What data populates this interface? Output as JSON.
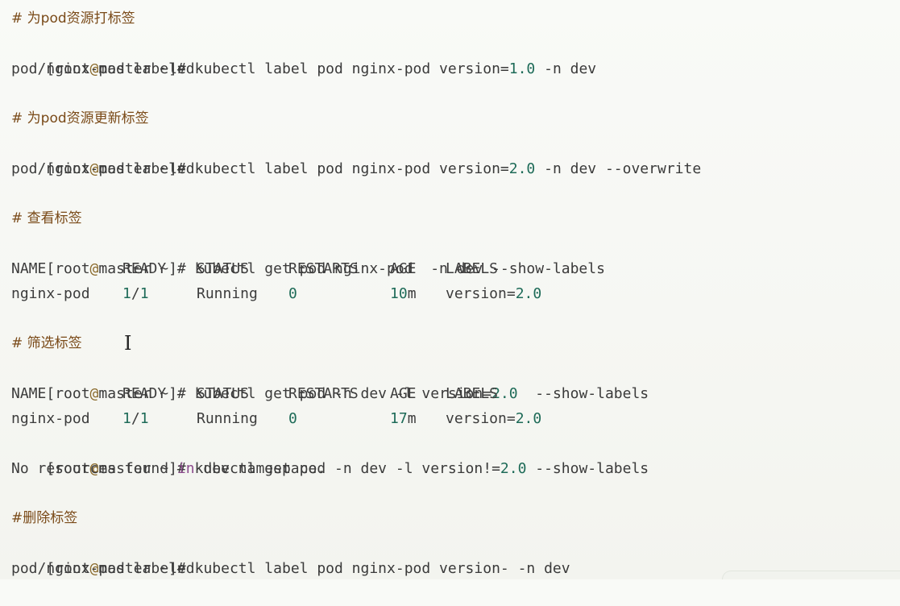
{
  "terminal": {
    "prompt": {
      "open": "[root",
      "at": "@",
      "host": "master",
      "rest": " ~]# "
    },
    "blocks": [
      {
        "comment": "# 为pod资源打标签",
        "command": "kubectl label pod nginx-pod version=1.0 -n dev",
        "output": "pod/nginx-pod labeled"
      },
      {
        "comment": "# 为pod资源更新标签",
        "command": "kubectl label pod nginx-pod version=2.0 -n dev --overwrite",
        "output": "pod/nginx-pod labeled"
      },
      {
        "comment": "# 查看标签",
        "command": "kubectl get pod nginx-pod  -n dev --show-labels",
        "table": {
          "headers": [
            "NAME",
            "READY",
            "STATUS",
            "RESTARTS",
            "AGE",
            "LABELS"
          ],
          "rows": [
            [
              "nginx-pod",
              "1/1",
              "Running",
              "0",
              "10m",
              "version=2.0"
            ]
          ]
        }
      },
      {
        "comment": "# 筛选标签",
        "command": "kubectl get pod -n dev -l version=2.0  --show-labels",
        "table": {
          "headers": [
            "NAME",
            "READY",
            "STATUS",
            "RESTARTS",
            "AGE",
            "LABELS"
          ],
          "rows": [
            [
              "nginx-pod",
              "1/1",
              "Running",
              "0",
              "17m",
              "version=2.0"
            ]
          ]
        },
        "command2": "kubectl get pod -n dev -l version!=2.0 --show-labels",
        "output2": "No resources found in dev namespace."
      },
      {
        "comment": "#删除标签",
        "command": "kubectl label pod nginx-pod version- -n dev",
        "output": "pod/nginx-pod labeled"
      }
    ]
  },
  "cursor": "I",
  "colors": {
    "background": "#f7f8f4",
    "comment": "#7a4a18",
    "prompt_at": "#8a6a2c",
    "number": "#1e6b58",
    "keyword": "#8b4a8c",
    "text": "#3c3c3c"
  }
}
